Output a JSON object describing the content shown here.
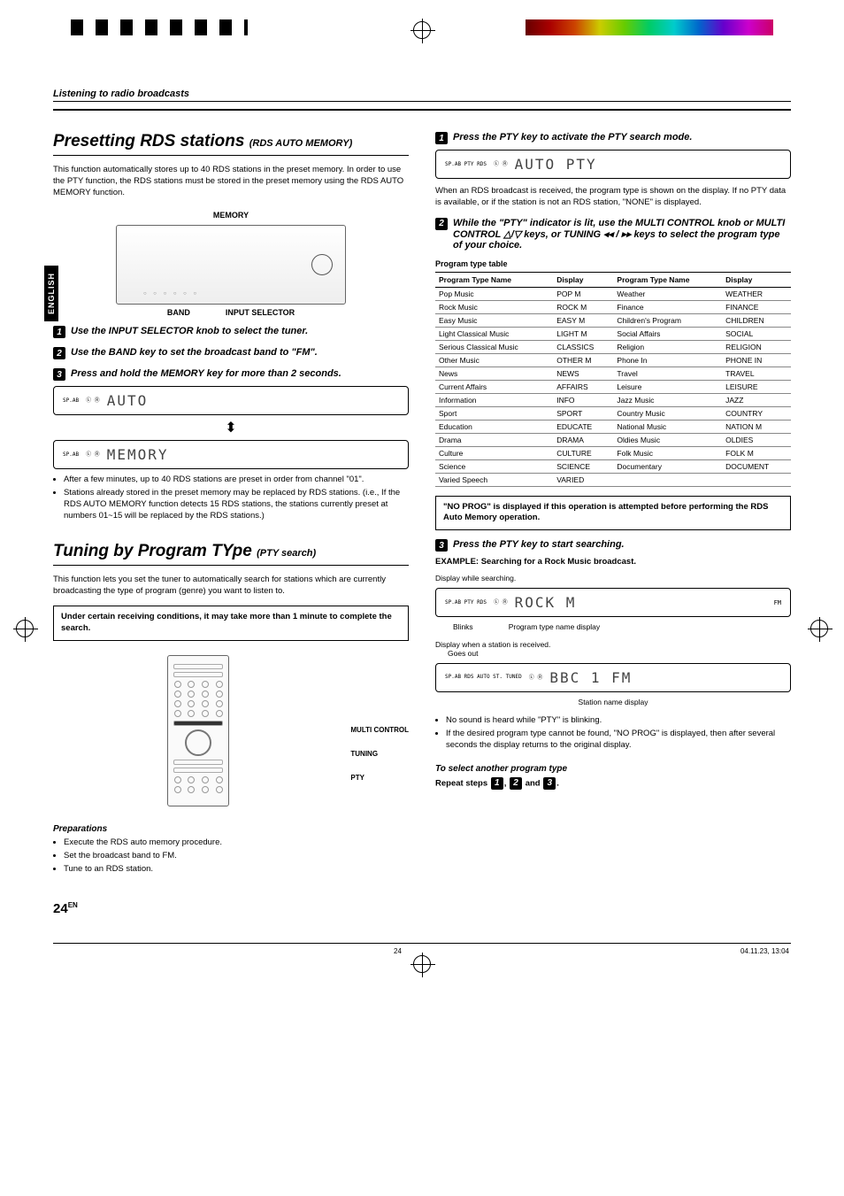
{
  "breadcrumb": "Listening to radio broadcasts",
  "language_tab": "ENGLISH",
  "sectionA": {
    "title": "Presetting RDS stations",
    "subtitle": "(RDS AUTO MEMORY)",
    "intro": "This function automatically stores up to 40 RDS stations in the preset memory. In order to use the PTY function, the RDS stations must be stored in the preset memory using the RDS AUTO MEMORY function.",
    "diagram_labels": {
      "memory": "MEMORY",
      "band": "BAND",
      "input_selector": "INPUT SELECTOR"
    },
    "step1": "Use the INPUT SELECTOR knob to select the tuner.",
    "step2": "Use the BAND key to set the broadcast band to \"FM\".",
    "step3": "Press and hold the MEMORY key for more than 2 seconds.",
    "lcd1_left_indicators": "SP.AB",
    "lcd1_seg": "AUTO",
    "lcd2_seg": "MEMORY",
    "bullets": [
      "After a few minutes, up to 40 RDS stations are preset in order from channel \"01\".",
      "Stations already stored in the preset memory may be replaced by RDS stations. (i.e., If the RDS AUTO MEMORY function detects 15 RDS stations, the stations currently preset at numbers 01~15 will be replaced by the RDS stations.)"
    ]
  },
  "sectionB": {
    "title": "Tuning by Program TYpe",
    "subtitle": "(PTY search)",
    "intro": "This function lets you set the tuner to automatically search for stations which are currently broadcasting the type of program (genre) you want to listen to.",
    "note": "Under certain receiving conditions, it may take more than 1 minute to complete the search.",
    "remote_labels": {
      "multi": "MULTI CONTROL",
      "tuning": "TUNING",
      "pty": "PTY"
    },
    "prep_title": "Preparations",
    "preparations": [
      "Execute the RDS auto memory procedure.",
      "Set the broadcast band to FM.",
      "Tune to an RDS station."
    ]
  },
  "right": {
    "step1": "Press the PTY key to activate the PTY search mode.",
    "lcd1_indicators": "SP.AB  PTY  RDS",
    "lcd1_seg": "AUTO PTY",
    "after1": "When an RDS broadcast is received, the program type is shown on the display. If no PTY data is available, or if the station is not an RDS station, \"NONE\" is displayed.",
    "step2": "While the \"PTY\" indicator is lit, use the MULTI CONTROL knob or MULTI CONTROL △/▽ keys, or TUNING  ◂◂ / ▸▸  keys to select the program type of your choice.",
    "table_title": "Program type table",
    "th1": "Program Type Name",
    "th2": "Display",
    "th3": "Program Type Name",
    "th4": "Display",
    "rows": [
      [
        "Pop Music",
        "POP M",
        "Weather",
        "WEATHER"
      ],
      [
        "Rock Music",
        "ROCK M",
        "Finance",
        "FINANCE"
      ],
      [
        "Easy Music",
        "EASY M",
        "Children's Program",
        "CHILDREN"
      ],
      [
        "Light Classical Music",
        "LIGHT M",
        "Social Affairs",
        "SOCIAL"
      ],
      [
        "Serious Classical Music",
        "CLASSICS",
        "Religion",
        "RELIGION"
      ],
      [
        "Other Music",
        "OTHER M",
        "Phone In",
        "PHONE IN"
      ],
      [
        "News",
        "NEWS",
        "Travel",
        "TRAVEL"
      ],
      [
        "Current Affairs",
        "AFFAIRS",
        "Leisure",
        "LEISURE"
      ],
      [
        "Information",
        "INFO",
        "Jazz Music",
        "JAZZ"
      ],
      [
        "Sport",
        "SPORT",
        "Country Music",
        "COUNTRY"
      ],
      [
        "Education",
        "EDUCATE",
        "National Music",
        "NATION M"
      ],
      [
        "Drama",
        "DRAMA",
        "Oldies Music",
        "OLDIES"
      ],
      [
        "Culture",
        "CULTURE",
        "Folk Music",
        "FOLK M"
      ],
      [
        "Science",
        "SCIENCE",
        "Documentary",
        "DOCUMENT"
      ],
      [
        "Varied Speech",
        "VARIED",
        "",
        ""
      ]
    ],
    "no_prog_note": "\"NO PROG\" is displayed if this operation is attempted before performing the RDS Auto Memory operation.",
    "step3": "Press the PTY key to start searching.",
    "example_title": "EXAMPLE: Searching for a Rock Music broadcast.",
    "searching_label": "Display while searching.",
    "lcd_search_indicators": "SP.AB  PTY  RDS",
    "lcd_search_seg": "ROCK M",
    "lcd_search_right": "FM",
    "blinks_label": "Blinks",
    "ptname_label": "Program type name display",
    "received_label": "Display when a station is received.",
    "goesout_label": "Goes out",
    "lcd_recv_indicators": "SP.AB RDS AUTO ST. TUNED",
    "lcd_recv_seg": "BBC        1  FM",
    "station_name_label": "Station name display",
    "after_bullets": [
      "No sound is heard while \"PTY\" is blinking.",
      "If the desired program type cannot be found, \"NO PROG\" is displayed, then after several seconds the display returns to the original display."
    ],
    "select_another_title": "To select another program type",
    "repeat_prefix": "Repeat steps ",
    "repeat_mid": ", ",
    "repeat_and": " and ",
    "repeat_suffix": "."
  },
  "footer": {
    "page_big": "24",
    "page_sup": "EN",
    "page_small": "24",
    "timestamp": "04.11.23, 13:04"
  }
}
